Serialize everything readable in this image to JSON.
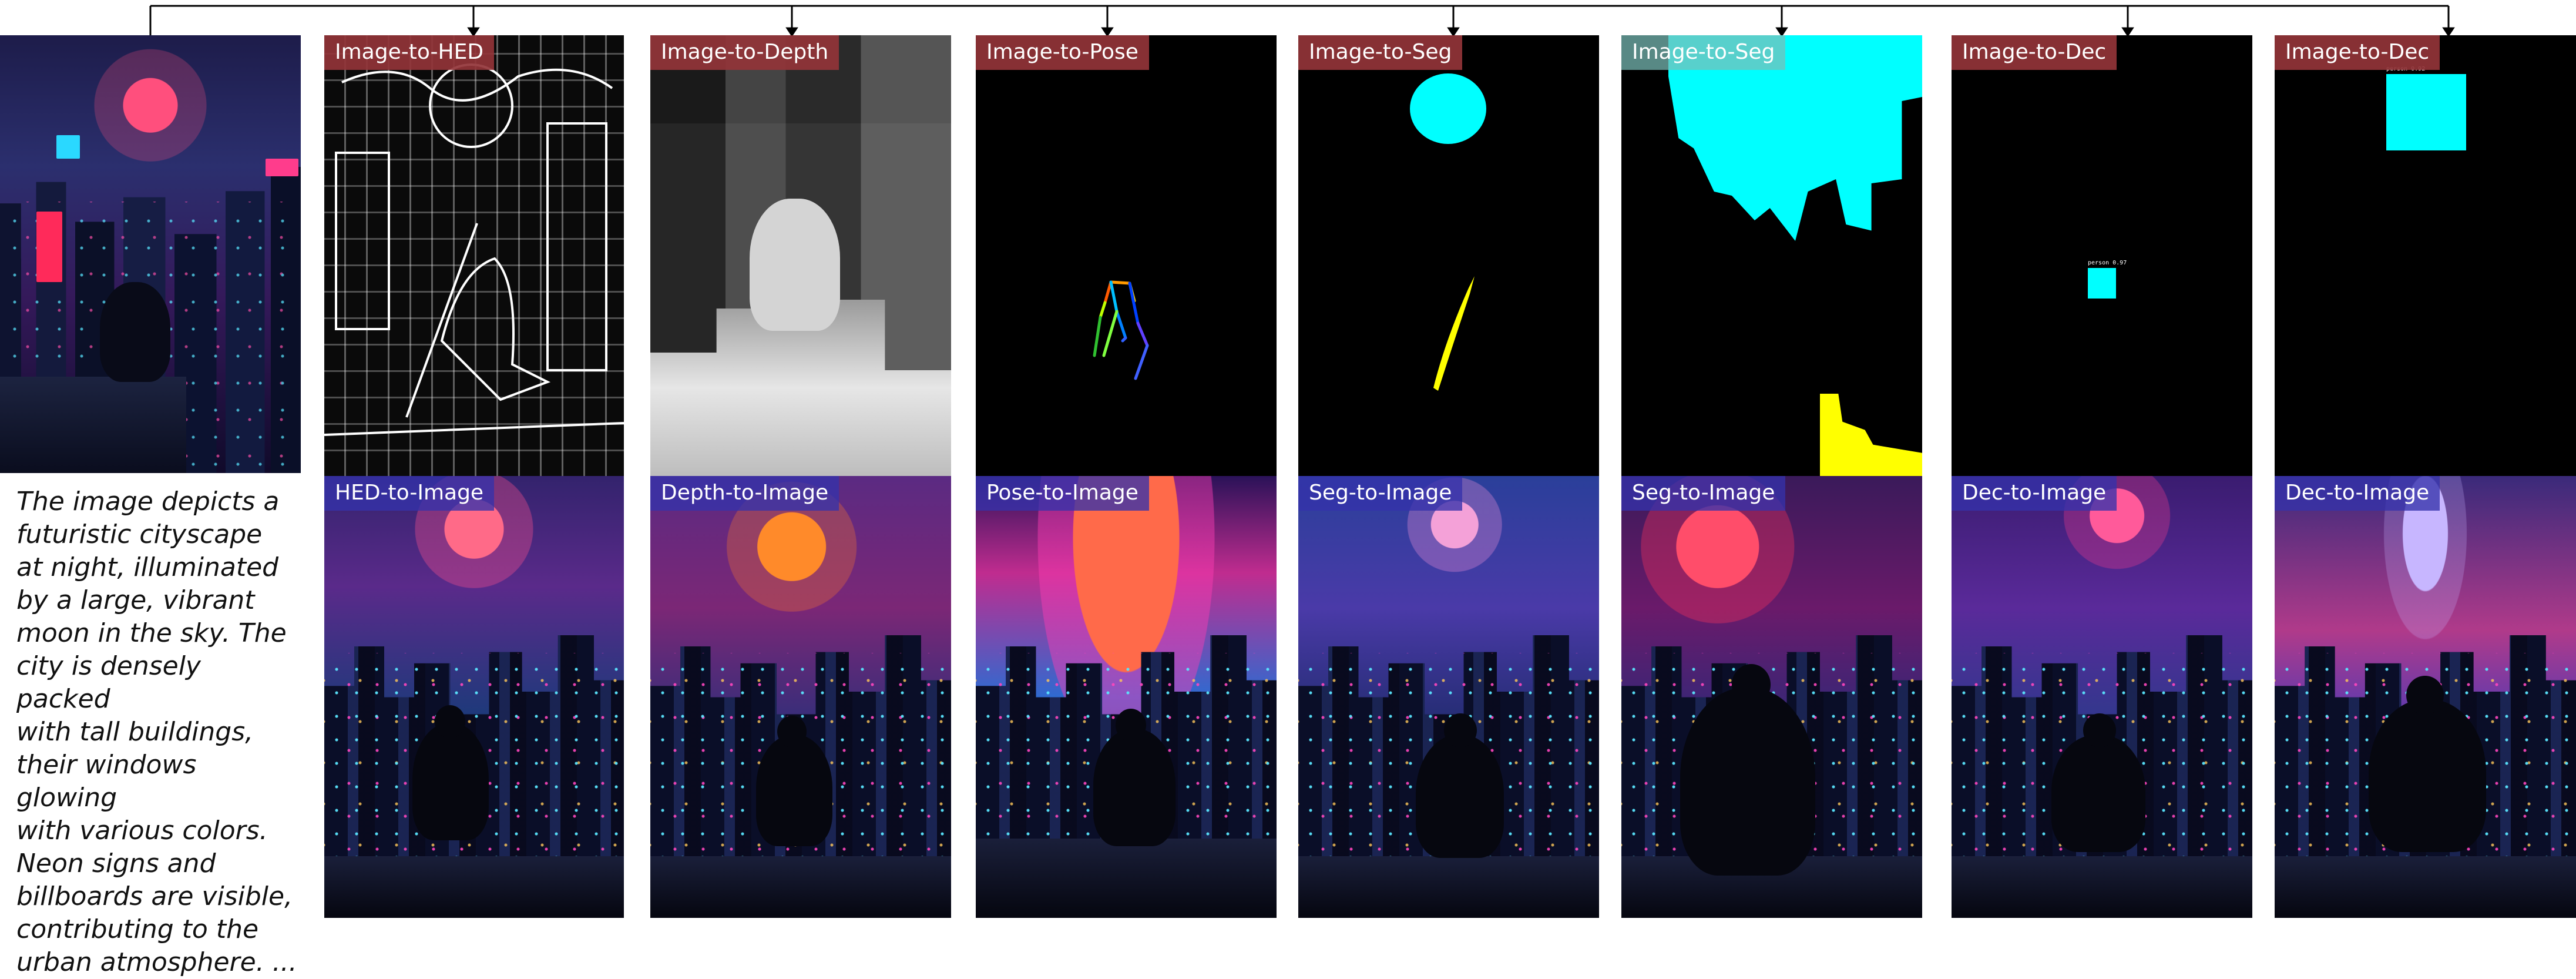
{
  "caption": "The image depicts a\nfuturistic cityscape\nat night, illuminated\nby a large, vibrant\nmoon in the sky. The\ncity is densely packed\nwith tall buildings,\ntheir windows glowing\nwith various colors.\nNeon signs and\nbillboards are visible,\ncontributing to the\nurban atmosphere. ...",
  "top_labels": [
    "Image-to-HED",
    "Image-to-Depth",
    "Image-to-Pose",
    "Image-to-Seg",
    "Image-to-Seg",
    "Image-to-Dec",
    "Image-to-Dec"
  ],
  "bottom_labels": [
    "HED-to-Image",
    "Depth-to-Image",
    "Pose-to-Image",
    "Seg-to-Image",
    "Seg-to-Image",
    "Dec-to-Image",
    "Dec-to-Image"
  ],
  "detection_tags": [
    "person 0.97",
    "person 0.92"
  ],
  "colors": {
    "top_label_bg": "#923438",
    "bottom_label_bg": "#3432aa",
    "seg_cyan": "#00ffff",
    "seg_yellow": "#ffff00",
    "connector": "#000000"
  }
}
